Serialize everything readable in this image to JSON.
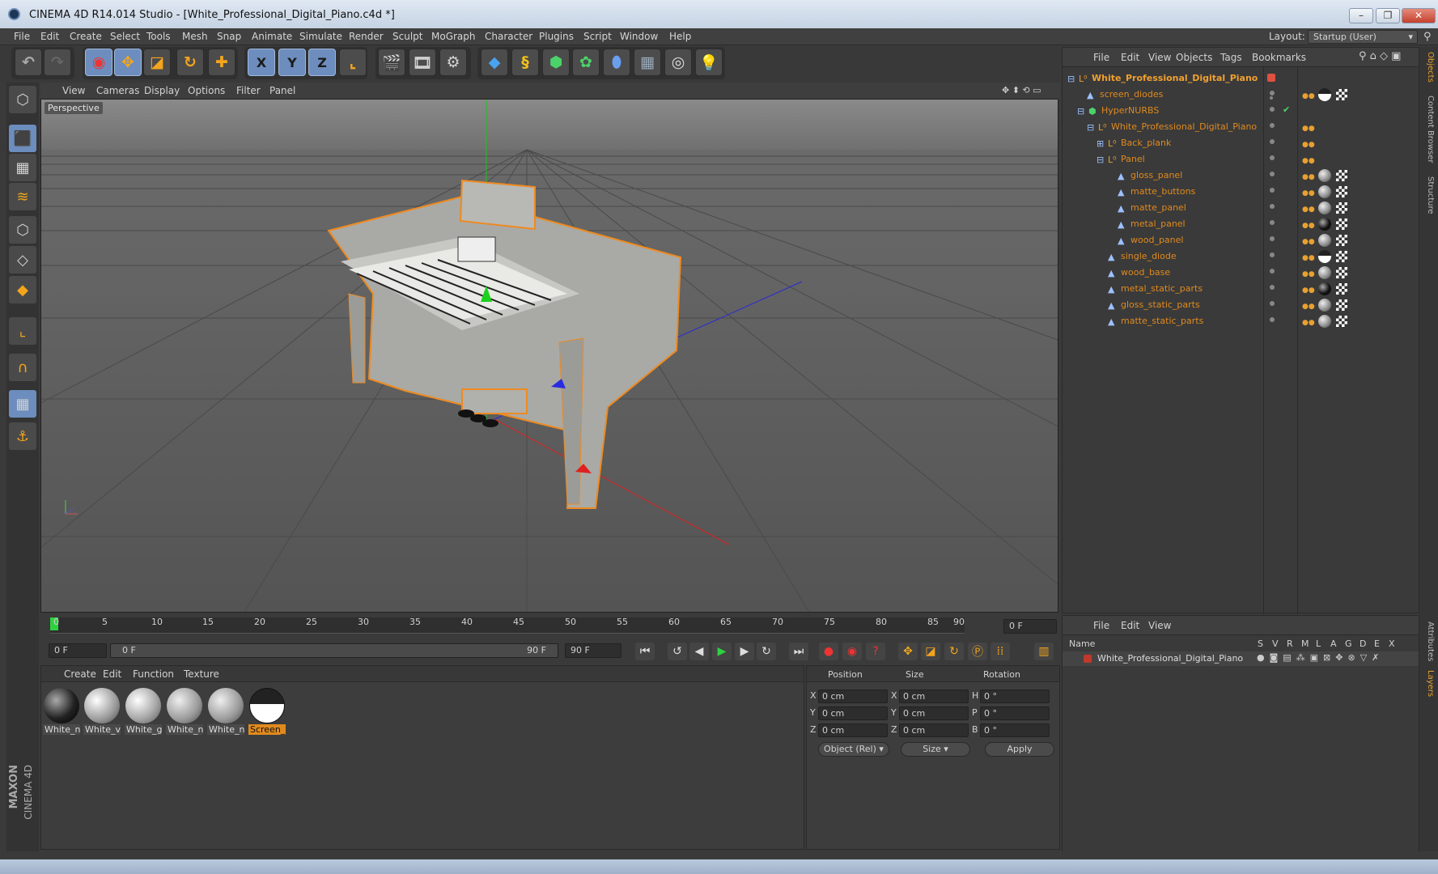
{
  "window": {
    "title": "CINEMA 4D R14.014 Studio - [White_Professional_Digital_Piano.c4d *]",
    "minimize": "–",
    "maximize": "❐",
    "close": "✕"
  },
  "menu": [
    "File",
    "Edit",
    "Create",
    "Select",
    "Tools",
    "Mesh",
    "Snap",
    "Animate",
    "Simulate",
    "Render",
    "Sculpt",
    "MoGraph",
    "Character",
    "Plugins",
    "Script",
    "Window",
    "Help"
  ],
  "layout": {
    "label": "Layout:",
    "value": "Startup (User)"
  },
  "toolbar": {
    "x_label": "X",
    "y_label": "Y",
    "z_label": "Z"
  },
  "viewport": {
    "menu": [
      "View",
      "Cameras",
      "Display",
      "Options",
      "Filter",
      "Panel"
    ],
    "label": "Perspective"
  },
  "timeline": {
    "ticks": [
      "0",
      "5",
      "10",
      "15",
      "20",
      "25",
      "30",
      "35",
      "40",
      "45",
      "50",
      "55",
      "60",
      "65",
      "70",
      "75",
      "80",
      "85",
      "90"
    ],
    "current_frame": "0 F",
    "start_field": "0 F",
    "range_start": "0 F",
    "range_end": "90 F",
    "end_field": "90 F"
  },
  "materials": {
    "menu": [
      "Create",
      "Edit",
      "Function",
      "Texture"
    ],
    "items": [
      {
        "label": "White_n",
        "style": "dark"
      },
      {
        "label": "White_v",
        "style": "light"
      },
      {
        "label": "White_g",
        "style": "light"
      },
      {
        "label": "White_n",
        "style": "light"
      },
      {
        "label": "White_n",
        "style": "light"
      },
      {
        "label": "Screen_l",
        "style": "screen",
        "selected": true
      }
    ]
  },
  "coordinates": {
    "headers": {
      "position": "Position",
      "size": "Size",
      "rotation": "Rotation"
    },
    "rows": [
      {
        "axis": "X",
        "pos": "0 cm",
        "size_axis": "X",
        "size": "0 cm",
        "rot_axis": "H",
        "rot": "0 °"
      },
      {
        "axis": "Y",
        "pos": "0 cm",
        "size_axis": "Y",
        "size": "0 cm",
        "rot_axis": "P",
        "rot": "0 °"
      },
      {
        "axis": "Z",
        "pos": "0 cm",
        "size_axis": "Z",
        "size": "0 cm",
        "rot_axis": "B",
        "rot": "0 °"
      }
    ],
    "mode": "Object (Rel)",
    "size_mode": "Size",
    "apply": "Apply"
  },
  "objects": {
    "menu": [
      "File",
      "Edit",
      "View",
      "Objects",
      "Tags",
      "Bookmarks"
    ],
    "rows": [
      {
        "name": "White_Professional_Digital_Piano",
        "level": 0,
        "type": "null",
        "expand": "⊟",
        "tags": "none"
      },
      {
        "name": "screen_diodes",
        "level": 1,
        "type": "poly",
        "expand": "",
        "tags": "screen"
      },
      {
        "name": "HyperNURBS",
        "level": 1,
        "type": "nurbs",
        "expand": "⊟",
        "tags": "check"
      },
      {
        "name": "White_Professional_Digital_Piano",
        "level": 2,
        "type": "null",
        "expand": "⊟",
        "tags": "dots"
      },
      {
        "name": "Back_plank",
        "level": 3,
        "type": "null",
        "expand": "⊞",
        "tags": "dots"
      },
      {
        "name": "Panel",
        "level": 3,
        "type": "null",
        "expand": "⊟",
        "tags": "dots"
      },
      {
        "name": "gloss_panel",
        "level": 4,
        "type": "poly",
        "expand": "",
        "tags": "mat"
      },
      {
        "name": "matte_buttons",
        "level": 4,
        "type": "poly",
        "expand": "",
        "tags": "mat"
      },
      {
        "name": "matte_panel",
        "level": 4,
        "type": "poly",
        "expand": "",
        "tags": "mat"
      },
      {
        "name": "metal_panel",
        "level": 4,
        "type": "poly",
        "expand": "",
        "tags": "mat"
      },
      {
        "name": "wood_panel",
        "level": 4,
        "type": "poly",
        "expand": "",
        "tags": "mat"
      },
      {
        "name": "single_diode",
        "level": 3,
        "type": "poly",
        "expand": "",
        "tags": "screen"
      },
      {
        "name": "wood_base",
        "level": 3,
        "type": "poly",
        "expand": "",
        "tags": "mat"
      },
      {
        "name": "metal_static_parts",
        "level": 3,
        "type": "poly",
        "expand": "",
        "tags": "mat"
      },
      {
        "name": "gloss_static_parts",
        "level": 3,
        "type": "poly",
        "expand": "",
        "tags": "mat"
      },
      {
        "name": "matte_static_parts",
        "level": 3,
        "type": "poly",
        "expand": "",
        "tags": "mat"
      }
    ]
  },
  "layers": {
    "menu": [
      "File",
      "Edit",
      "View"
    ],
    "columns": {
      "name": "Name",
      "flags": [
        "S",
        "V",
        "R",
        "M",
        "L",
        "A",
        "G",
        "D",
        "E",
        "X"
      ]
    },
    "rows": [
      {
        "name": "White_Professional_Digital_Piano",
        "color": "#c0392b"
      }
    ]
  },
  "side_tabs": [
    "Objects",
    "Content Browser",
    "Structure",
    "Attributes",
    "Layers"
  ],
  "brand": {
    "maxon": "MAXON",
    "product": "CINEMA 4D"
  },
  "colors": {
    "accent": "#e08a1e",
    "selection_blue": "#6c8dbd",
    "active_green": "#2fd13f"
  }
}
